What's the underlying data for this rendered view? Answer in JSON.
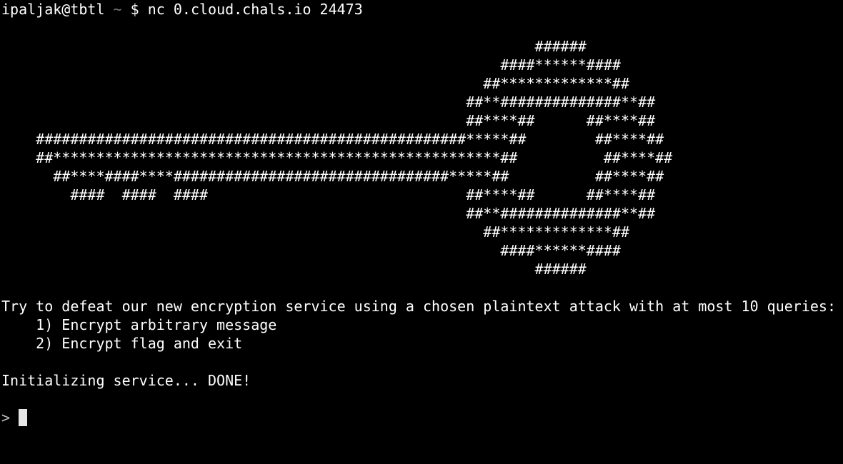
{
  "terminal": {
    "prompt": {
      "user_host": "ipaljak@tbtl",
      "cwd": "~",
      "symbol": "$",
      "command": "nc 0.cloud.chals.io 24473"
    },
    "ascii_art": [
      "                                                              ######",
      "                                                          ####******####",
      "                                                        ##*************##",
      "                                                      ##**##############**##",
      "                                                      ##****##      ##****##",
      "    ##################################################*****##        ##****##",
      "    ##****************************************************##          ##****##",
      "      ##****####****################################*****##          ##****##",
      "        ####  ####  ####                              ##****##      ##****##",
      "                                                      ##**##############**##",
      "                                                        ##*************##",
      "                                                          ####******####",
      "                                                              ######"
    ],
    "intro": "Try to defeat our new encryption service using a chosen plaintext attack with at most 10 queries:",
    "menu": [
      "    1) Encrypt arbitrary message",
      "    2) Encrypt flag and exit"
    ],
    "status": "Initializing service... DONE!",
    "input_prompt": ">"
  }
}
